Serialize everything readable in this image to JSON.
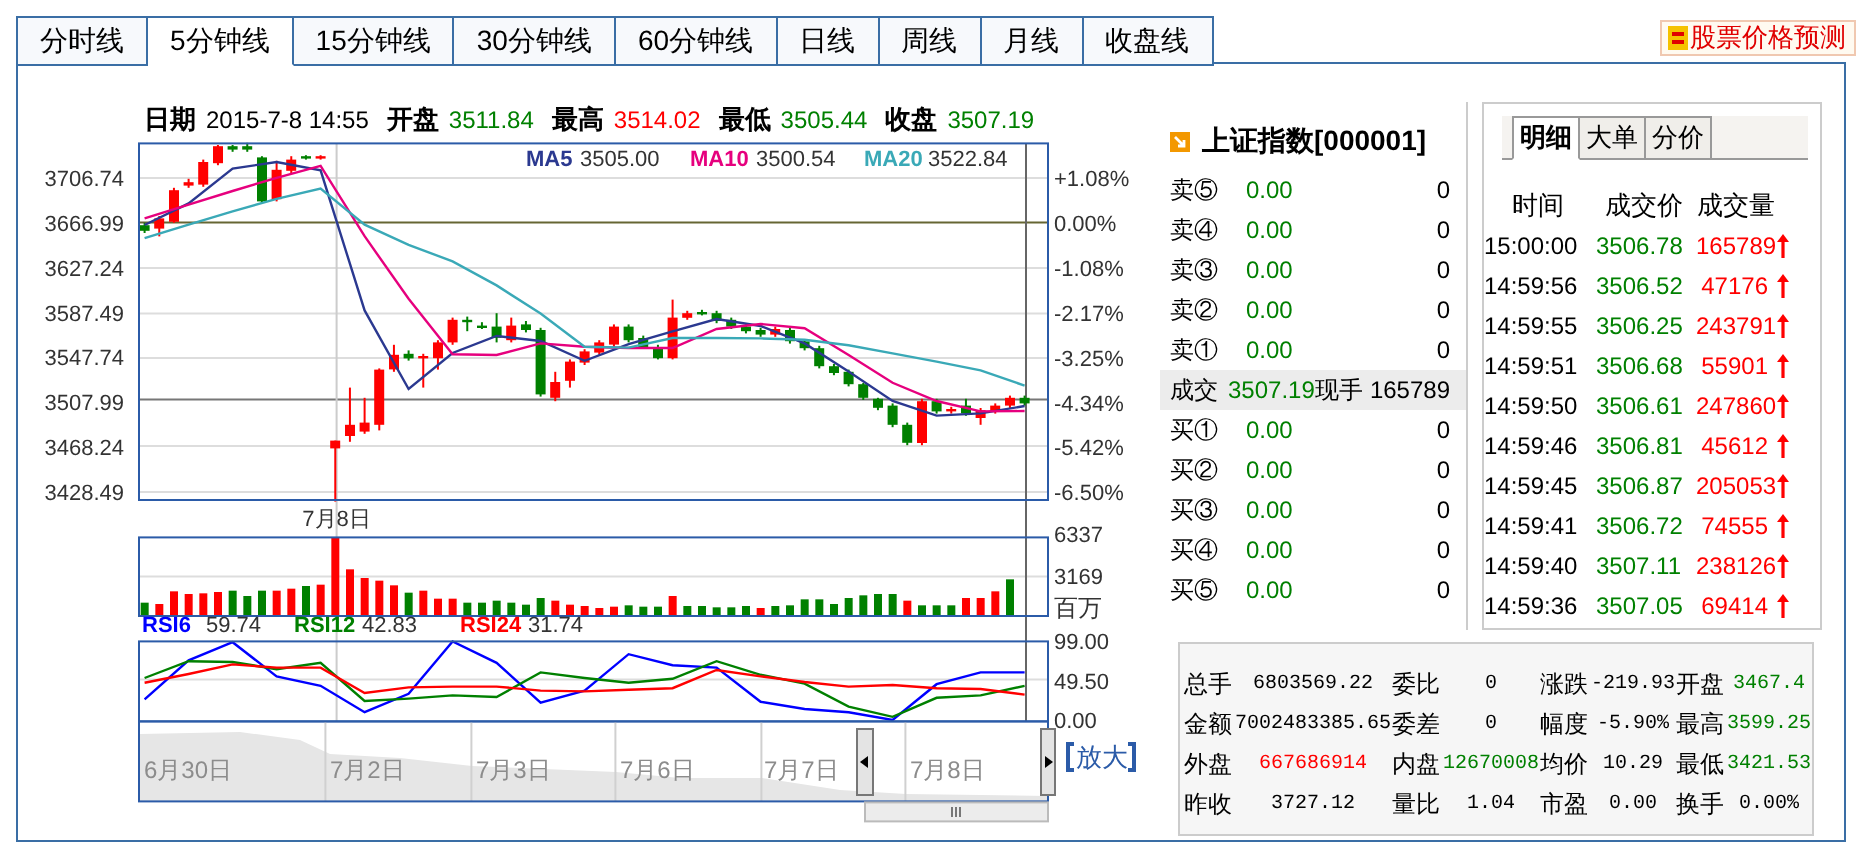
{
  "tabs": [
    {
      "label": "分时线",
      "selected": false
    },
    {
      "label": "5分钟线",
      "selected": true
    },
    {
      "label": "15分钟线",
      "selected": false
    },
    {
      "label": "30分钟线",
      "selected": false
    },
    {
      "label": "60分钟线",
      "selected": false
    },
    {
      "label": "日线",
      "selected": false
    },
    {
      "label": "周线",
      "selected": false
    },
    {
      "label": "月线",
      "selected": false
    },
    {
      "label": "收盘线",
      "selected": false
    }
  ],
  "forecast_button": {
    "label": "股票价格预测"
  },
  "quote_header": [
    {
      "label": "日期",
      "value": "2015-7-8 14:55",
      "color": "#000000"
    },
    {
      "label": "开盘",
      "value": "3511.84",
      "color": "#008000"
    },
    {
      "label": "最高",
      "value": "3514.02",
      "color": "#ff0000"
    },
    {
      "label": "最低",
      "value": "3505.44",
      "color": "#008000"
    },
    {
      "label": "收盘",
      "value": "3507.19",
      "color": "#008000"
    }
  ],
  "price_chart": {
    "date_marker": "7月8日",
    "candles": {
      "chart_data": {
        "type": "candlestick",
        "categories": [
          null,
          null,
          null,
          null,
          null,
          null,
          null,
          null,
          null,
          null,
          null,
          null,
          null,
          null,
          null,
          null,
          null,
          null,
          null,
          null,
          null,
          null,
          null,
          null,
          null,
          null,
          null,
          null,
          null,
          null,
          null,
          null,
          null,
          null,
          null,
          null,
          null,
          null,
          null,
          null,
          null,
          null,
          null,
          null,
          null,
          null,
          null,
          null,
          null,
          null,
          null,
          null,
          null,
          null,
          null,
          null,
          null,
          null,
          null,
          null,
          null
        ],
        "ylim": [
          3421.4,
          3737.4
        ],
        "yticks": [
          {
            "value": 3706.74,
            "label": "3706.74"
          },
          {
            "value": 3666.99,
            "label": "3666.99"
          },
          {
            "value": 3627.24,
            "label": "3627.24"
          },
          {
            "value": 3587.49,
            "label": "3587.49"
          },
          {
            "value": 3547.74,
            "label": "3547.74"
          },
          {
            "value": 3507.99,
            "label": "3507.99"
          },
          {
            "value": 3468.24,
            "label": "3468.24"
          },
          {
            "value": 3428.49,
            "label": "3428.49"
          }
        ],
        "ohlc": [
          [
            3665,
            3667,
            3658,
            3660
          ],
          [
            3662,
            3673,
            3655,
            3671
          ],
          [
            3668,
            3698,
            3667,
            3696
          ],
          [
            3700,
            3706,
            3698,
            3703
          ],
          [
            3701,
            3723,
            3699,
            3721
          ],
          [
            3720,
            3736,
            3718,
            3735
          ],
          [
            3735,
            3736,
            3730,
            3732
          ],
          [
            3735,
            3738,
            3730,
            3732
          ],
          [
            3725,
            3726,
            3684,
            3686
          ],
          [
            3688,
            3722,
            3686,
            3714
          ],
          [
            3713,
            3726,
            3711,
            3723
          ],
          [
            3726,
            3727,
            3723,
            3724
          ],
          [
            3724,
            3727,
            3723,
            3726
          ],
          [
            3467,
            3474,
            3420,
            3474
          ],
          [
            3478,
            3521,
            3473,
            3488
          ],
          [
            3482,
            3512,
            3480,
            3490
          ],
          [
            3488,
            3538,
            3483,
            3537
          ],
          [
            3537,
            3559,
            3535,
            3550
          ],
          [
            3551,
            3554,
            3545,
            3547
          ],
          [
            3547,
            3551,
            3521,
            3549
          ],
          [
            3547,
            3563,
            3537,
            3561
          ],
          [
            3561,
            3583,
            3559,
            3581
          ],
          [
            3581,
            3584,
            3571,
            3580
          ],
          [
            3576,
            3579,
            3573,
            3575
          ],
          [
            3575,
            3587,
            3561,
            3565
          ],
          [
            3563,
            3583,
            3561,
            3576
          ],
          [
            3577,
            3580,
            3570,
            3572
          ],
          [
            3572,
            3574,
            3513,
            3515
          ],
          [
            3512,
            3535,
            3509,
            3526
          ],
          [
            3527,
            3546,
            3521,
            3544
          ],
          [
            3543,
            3555,
            3541,
            3553
          ],
          [
            3552,
            3563,
            3550,
            3561
          ],
          [
            3559,
            3577,
            3557,
            3575
          ],
          [
            3575,
            3577,
            3561,
            3563
          ],
          [
            3565,
            3567,
            3556,
            3557
          ],
          [
            3557,
            3559,
            3546,
            3547
          ],
          [
            3547,
            3599,
            3546,
            3583
          ],
          [
            3583,
            3589,
            3581,
            3587
          ],
          [
            3588,
            3590,
            3585,
            3587
          ],
          [
            3587,
            3589,
            3578,
            3580
          ],
          [
            3581,
            3583,
            3573,
            3575
          ],
          [
            3575,
            3577,
            3569,
            3571
          ],
          [
            3572,
            3574,
            3566,
            3568
          ],
          [
            3568,
            3575,
            3566,
            3573
          ],
          [
            3572,
            3574,
            3560,
            3562
          ],
          [
            3562,
            3564,
            3554,
            3556
          ],
          [
            3556,
            3558,
            3538,
            3540
          ],
          [
            3540,
            3542,
            3532,
            3534
          ],
          [
            3535,
            3537,
            3522,
            3524
          ],
          [
            3524,
            3525,
            3510,
            3512
          ],
          [
            3511,
            3512,
            3501,
            3503
          ],
          [
            3505,
            3507,
            3486,
            3488
          ],
          [
            3488,
            3490,
            3470,
            3472
          ],
          [
            3472,
            3511,
            3470,
            3509
          ],
          [
            3509,
            3511,
            3498,
            3500
          ],
          [
            3500,
            3504,
            3498,
            3502
          ],
          [
            3505,
            3511,
            3496,
            3498
          ],
          [
            3494,
            3503,
            3488,
            3501
          ],
          [
            3500,
            3507,
            3498,
            3505
          ],
          [
            3505,
            3514,
            3503,
            3512
          ],
          [
            3512,
            3514,
            3505,
            3507
          ]
        ]
      }
    },
    "moving_averages": {
      "legend_values": [
        "3505.00",
        "3500.54",
        "3522.84"
      ],
      "chart_data": {
        "type": "line",
        "categories": [
          null,
          null,
          null,
          null,
          null,
          null,
          null,
          null,
          null,
          null,
          null,
          null,
          null,
          null,
          null,
          null,
          null,
          null,
          null,
          null,
          null
        ],
        "ylim": [
          -6.69,
          1.92
        ],
        "yticks": [
          {
            "value": 1.08,
            "label": "+1.08%"
          },
          {
            "value": 0,
            "label": "0.00%"
          },
          {
            "value": -1.08,
            "label": "-1.08%"
          },
          {
            "value": -2.17,
            "label": "-2.17%"
          },
          {
            "value": -3.25,
            "label": "-3.25%"
          },
          {
            "value": -4.34,
            "label": "-4.34%"
          },
          {
            "value": -5.42,
            "label": "-5.42%"
          },
          {
            "value": -6.5,
            "label": "-6.50%"
          }
        ],
        "series": [
          {
            "name": "MA5",
            "color": "#2b3990",
            "values": [
              -0.05,
              0.47,
              1.31,
              1.47,
              1.27,
              -2.11,
              -4.01,
              -3.14,
              -2.73,
              -2.85,
              -3.33,
              -2.93,
              -2.62,
              -2.32,
              -2.49,
              -2.91,
              -3.59,
              -4.3,
              -4.65,
              -4.6,
              -4.42
            ]
          },
          {
            "name": "MA10",
            "color": "#e6007e",
            "values": [
              0.11,
              0.44,
              0.77,
              1.09,
              1.38,
              -0.32,
              -1.83,
              -3.17,
              -3.19,
              -2.91,
              -2.99,
              -3.02,
              -3.02,
              -2.56,
              -2.44,
              -2.54,
              -3.19,
              -3.86,
              -4.3,
              -4.55,
              -4.54
            ]
          },
          {
            "name": "MA20",
            "color": "#3aa9b7",
            "values": [
              -0.37,
              -0.04,
              0.28,
              0.58,
              0.83,
              -0.04,
              -0.53,
              -0.93,
              -1.51,
              -2.19,
              -2.99,
              -3.01,
              -2.78,
              -2.78,
              -2.79,
              -2.82,
              -2.95,
              -3.15,
              -3.35,
              -3.56,
              -3.93
            ]
          }
        ]
      }
    }
  },
  "volume_chart": {
    "ticks": [
      "6337",
      "3169"
    ],
    "unit": "百万"
  },
  "rsi_chart": {
    "legend_values": [
      "59.74",
      "42.83",
      "31.74"
    ],
    "chart_data": {
      "type": "line",
      "categories": [
        null,
        null,
        null,
        null,
        null,
        null,
        null,
        null,
        null,
        null,
        null,
        null,
        null,
        null,
        null,
        null,
        null,
        null,
        null,
        null,
        null
      ],
      "ylim": [
        -1.7,
        99
      ],
      "yticks": [
        {
          "value": 99,
          "label": "99.00"
        },
        {
          "value": 49.5,
          "label": "49.50"
        },
        {
          "value": 0,
          "label": "0.00"
        }
      ],
      "series": [
        {
          "name": "RSI6",
          "color": "#0000ff",
          "values": [
            26,
            75,
            98,
            55,
            43,
            10,
            33,
            99,
            72,
            22,
            37,
            83,
            69,
            66,
            23,
            14,
            10,
            0,
            45,
            60,
            60
          ]
        },
        {
          "name": "RSI12",
          "color": "#008000",
          "values": [
            53,
            74,
            73,
            64,
            72,
            24,
            27,
            31,
            29,
            60,
            53,
            47,
            52,
            74,
            57,
            46,
            17,
            4,
            28,
            31,
            43
          ]
        },
        {
          "name": "RSI24",
          "color": "#ff0000",
          "values": [
            47,
            58,
            70,
            66,
            66,
            34,
            41,
            42,
            42,
            37,
            36,
            38,
            40,
            63,
            55,
            48,
            42,
            44,
            40,
            39,
            32
          ]
        }
      ]
    }
  },
  "navigator": {
    "dates": [
      "6月30日",
      "7月2日",
      "7月3日",
      "7月6日",
      "7月7日",
      "7月8日"
    ],
    "zoom_button": "放大"
  },
  "order_book": {
    "title": "上证指数[000001]",
    "rows": [
      {
        "kind": "quote",
        "label": "卖⑤",
        "price": "0.00",
        "volume": "0"
      },
      {
        "kind": "quote",
        "label": "卖④",
        "price": "0.00",
        "volume": "0"
      },
      {
        "kind": "quote",
        "label": "卖③",
        "price": "0.00",
        "volume": "0"
      },
      {
        "kind": "quote",
        "label": "卖②",
        "price": "0.00",
        "volume": "0"
      },
      {
        "kind": "quote",
        "label": "卖①",
        "price": "0.00",
        "volume": "0"
      },
      {
        "kind": "trade",
        "label": "成交",
        "price": "3507.19",
        "sub_label": "现手",
        "volume": "165789"
      },
      {
        "kind": "quote",
        "label": "买①",
        "price": "0.00",
        "volume": "0"
      },
      {
        "kind": "quote",
        "label": "买②",
        "price": "0.00",
        "volume": "0"
      },
      {
        "kind": "quote",
        "label": "买③",
        "price": "0.00",
        "volume": "0"
      },
      {
        "kind": "quote",
        "label": "买④",
        "price": "0.00",
        "volume": "0"
      },
      {
        "kind": "quote",
        "label": "买⑤",
        "price": "0.00",
        "volume": "0"
      }
    ]
  },
  "trade_detail": {
    "tabs": [
      {
        "label": "明细",
        "selected": true
      },
      {
        "label": "大单",
        "selected": false
      },
      {
        "label": "分价",
        "selected": false
      }
    ],
    "columns": [
      "时间",
      "成交价",
      "成交量"
    ],
    "rows": [
      {
        "time": "15:00:00",
        "price": "3506.78",
        "volume": "165789",
        "rising": true
      },
      {
        "time": "14:59:56",
        "price": "3506.52",
        "volume": "47176",
        "rising": true
      },
      {
        "time": "14:59:55",
        "price": "3506.25",
        "volume": "243791",
        "rising": true
      },
      {
        "time": "14:59:51",
        "price": "3506.68",
        "volume": "55901",
        "rising": true
      },
      {
        "time": "14:59:50",
        "price": "3506.61",
        "volume": "247860",
        "rising": true
      },
      {
        "time": "14:59:46",
        "price": "3506.81",
        "volume": "45612",
        "rising": true
      },
      {
        "time": "14:59:45",
        "price": "3506.87",
        "volume": "205053",
        "rising": true
      },
      {
        "time": "14:59:41",
        "price": "3506.72",
        "volume": "74555",
        "rising": true
      },
      {
        "time": "14:59:40",
        "price": "3507.11",
        "volume": "238126",
        "rising": true
      },
      {
        "time": "14:59:36",
        "price": "3507.05",
        "volume": "69414",
        "rising": true
      }
    ]
  },
  "stats": [
    [
      {
        "label": "总手",
        "value": "6803569.22",
        "color": "#000000"
      },
      {
        "label": "委比",
        "value": "0",
        "color": "#000000"
      },
      {
        "label": "涨跌",
        "value": "-219.93",
        "color": "#000000"
      },
      {
        "label": "开盘",
        "value": "3467.4",
        "color": "#008000"
      }
    ],
    [
      {
        "label": "金额",
        "value": "7002483385.65",
        "color": "#000000"
      },
      {
        "label": "委差",
        "value": "0",
        "color": "#000000"
      },
      {
        "label": "幅度",
        "value": "-5.90%",
        "color": "#000000"
      },
      {
        "label": "最高",
        "value": "3599.25",
        "color": "#008000"
      }
    ],
    [
      {
        "label": "外盘",
        "value": "667686914",
        "color": "#ff0000"
      },
      {
        "label": "内盘",
        "value": "12670008",
        "color": "#008000"
      },
      {
        "label": "均价",
        "value": "10.29",
        "color": "#000000"
      },
      {
        "label": "最低",
        "value": "3421.53",
        "color": "#008000"
      }
    ],
    [
      {
        "label": "昨收",
        "value": "3727.12",
        "color": "#000000"
      },
      {
        "label": "量比",
        "value": "1.04",
        "color": "#000000"
      },
      {
        "label": "市盈",
        "value": "0.00",
        "color": "#000000"
      },
      {
        "label": "换手",
        "value": "0.00%",
        "color": "#000000"
      }
    ]
  ]
}
